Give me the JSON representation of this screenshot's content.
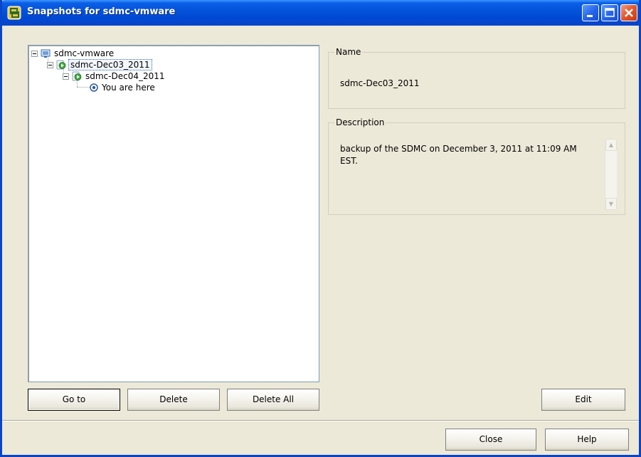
{
  "window": {
    "title": "Snapshots for sdmc-vmware",
    "accent_color": "#0a45c8",
    "background_color": "#ece9d8"
  },
  "title_controls": {
    "minimize_icon": "minimize-icon",
    "maximize_icon": "maximize-icon",
    "close_icon": "close-icon"
  },
  "tree": {
    "root": {
      "label": "sdmc-vmware",
      "icon": "virtual-machine-icon"
    },
    "snapshot1": {
      "label": "sdmc-Dec03_2011",
      "icon": "snapshot-icon",
      "selected": true
    },
    "snapshot2": {
      "label": "sdmc-Dec04_2011",
      "icon": "snapshot-icon"
    },
    "current": {
      "label": "You are here",
      "icon": "you-are-here-icon"
    }
  },
  "name_group": {
    "legend": "Name",
    "value": "sdmc-Dec03_2011"
  },
  "description_group": {
    "legend": "Description",
    "text": "backup of the SDMC on December 3, 2011 at 11:09 AM EST."
  },
  "buttons": {
    "goto": "Go to",
    "delete": "Delete",
    "delete_all": "Delete All",
    "edit": "Edit",
    "close": "Close",
    "help": "Help"
  }
}
